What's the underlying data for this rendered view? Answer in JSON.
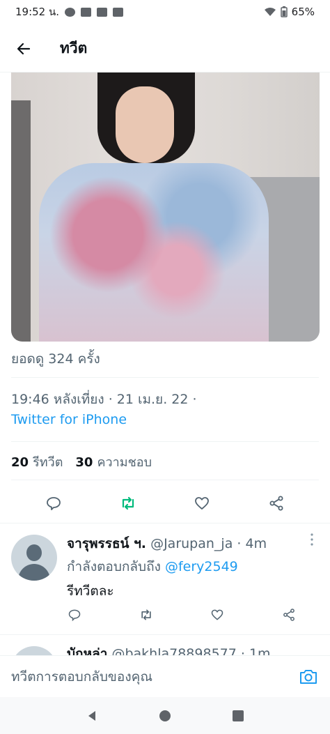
{
  "status_bar": {
    "time": "19:52 น.",
    "battery": "65%"
  },
  "header": {
    "title": "ทวีต"
  },
  "tweet": {
    "views": "ยอดดู 324 ครั้ง",
    "timestamp": "19:46 หลังเที่ยง · 21 เม.ย. 22 ·",
    "source": "Twitter for iPhone",
    "retweets_count": "20",
    "retweets_label": "รีทวีต",
    "likes_count": "30",
    "likes_label": "ความชอบ"
  },
  "reply": {
    "name": "จารุพรรธน์ ฯ.",
    "handle": "@Jarupan_ja",
    "time": "· 4m",
    "replying_to_label": "กำลังตอบกลับถึง",
    "replying_to_handle": "@fery2549",
    "text": "รีทวีตละ"
  },
  "reply2": {
    "name": "บักหล่า",
    "handle": "@bakhla78898577",
    "time": "· 1m"
  },
  "compose": {
    "placeholder": "ทวีตการตอบกลับของคุณ"
  },
  "colors": {
    "accent": "#1d9bf0",
    "retweet_green": "#00ba7c",
    "muted": "#536471"
  },
  "icons": [
    "back-arrow-icon",
    "reply-icon",
    "retweet-icon",
    "like-icon",
    "share-icon",
    "camera-icon",
    "more-icon"
  ]
}
